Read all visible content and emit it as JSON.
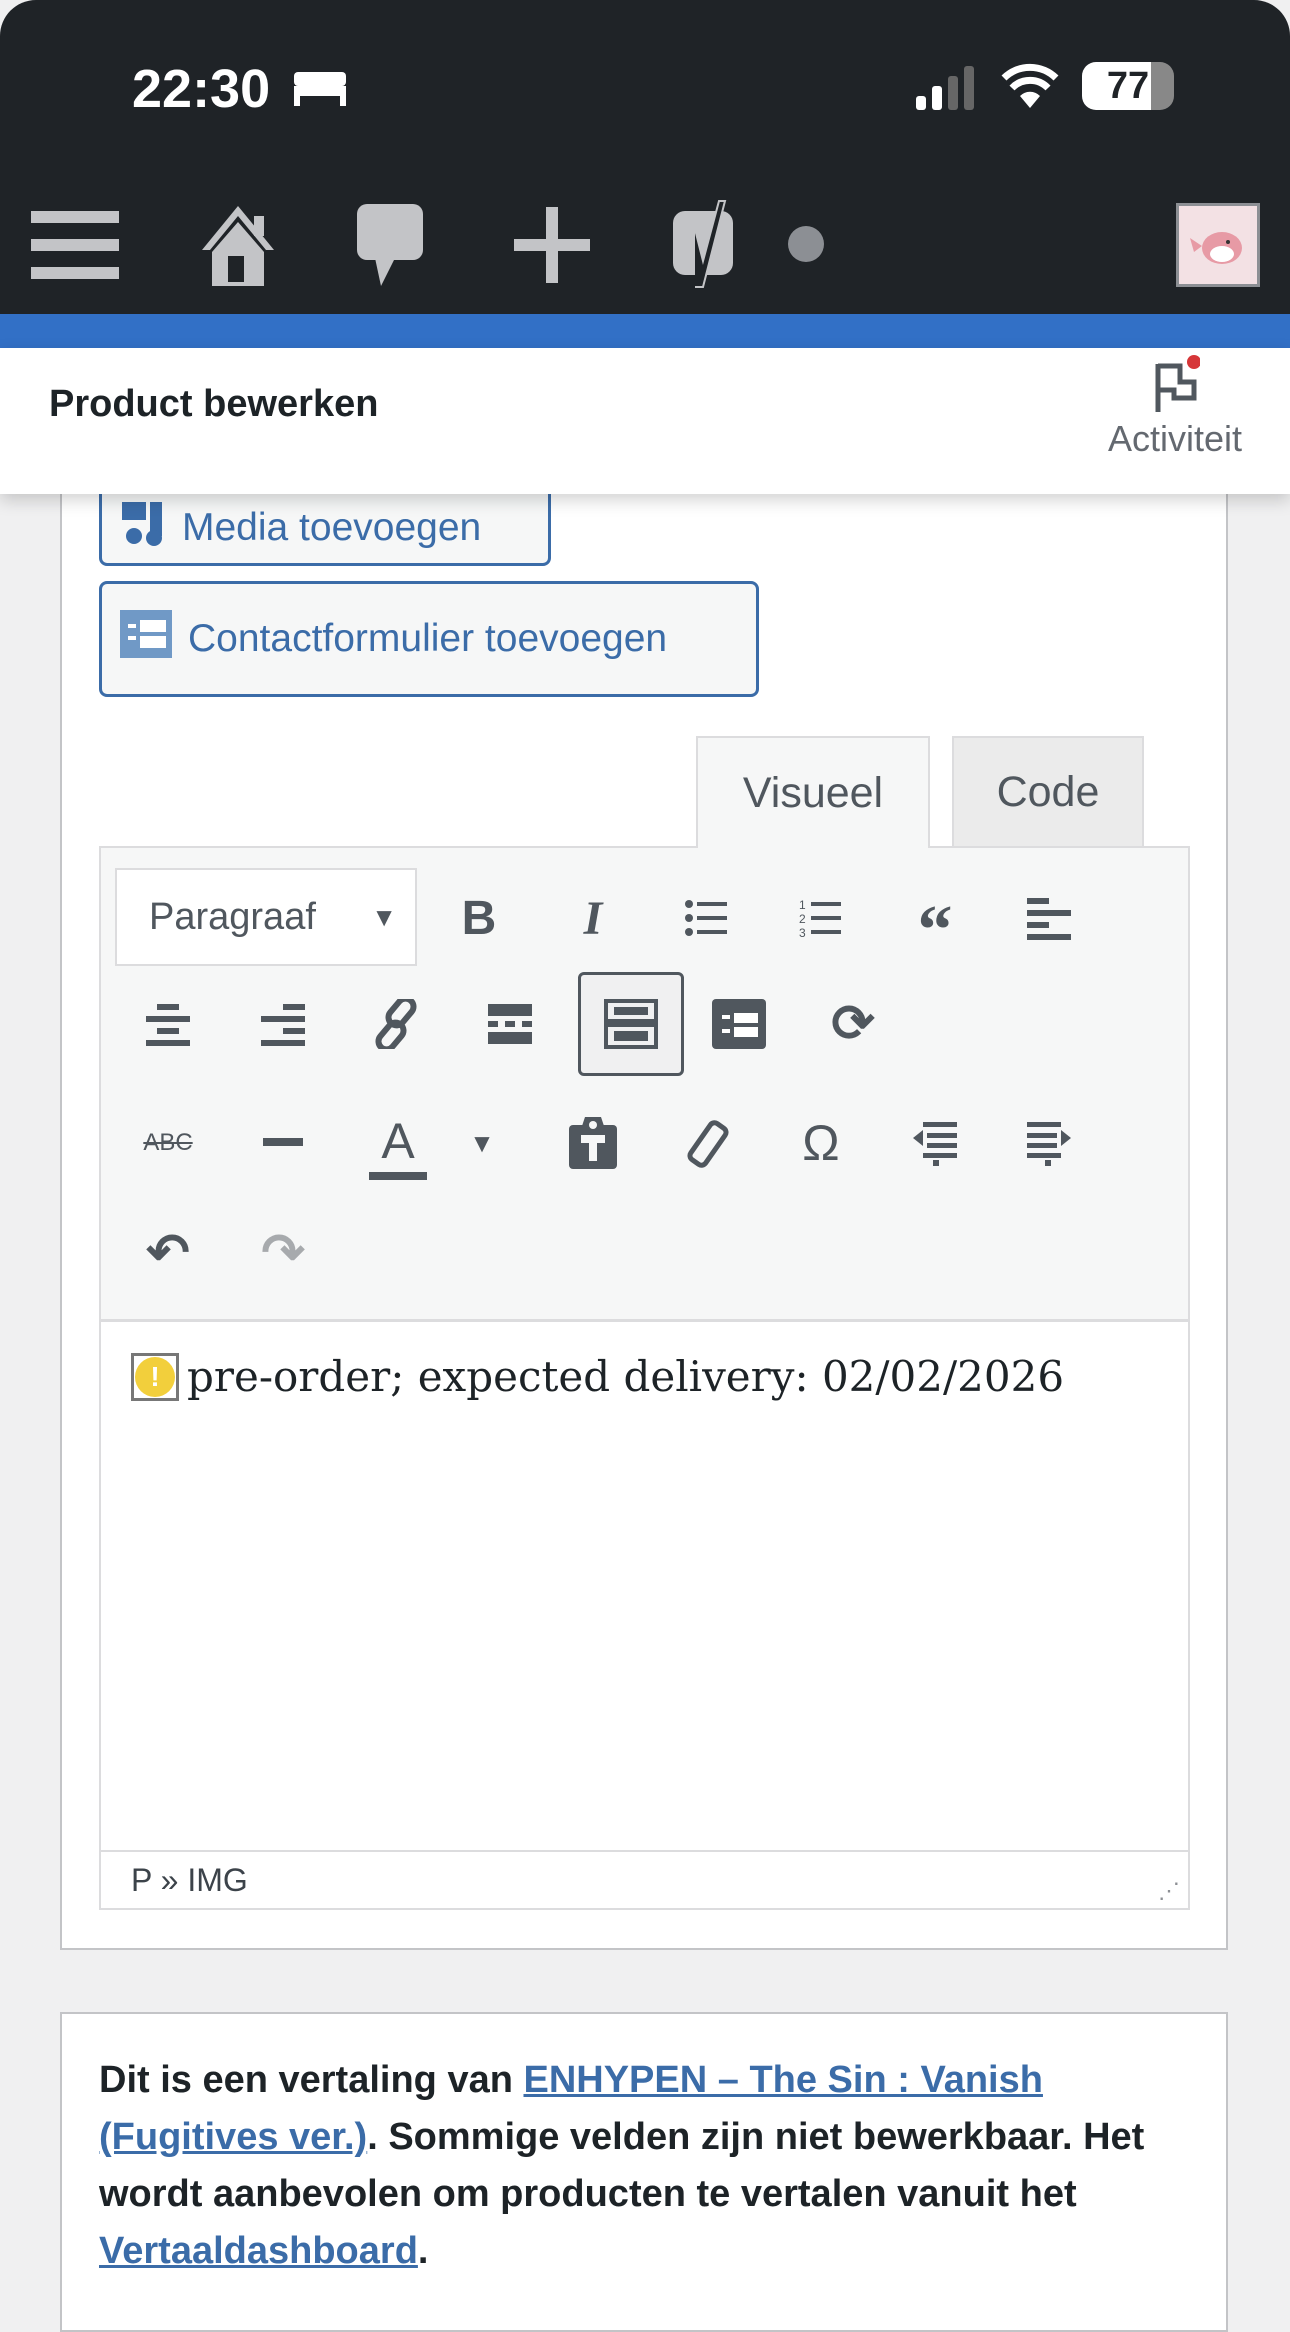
{
  "status_bar": {
    "time": "22:30",
    "battery": "77"
  },
  "admin_bar": {
    "icons": [
      "menu-icon",
      "home-icon",
      "comments-icon",
      "new-icon",
      "yoast-icon",
      "status-dot-icon",
      "avatar"
    ]
  },
  "header": {
    "title": "Product bewerken",
    "activity_label": "Activiteit"
  },
  "editor": {
    "media_button": "Media toevoegen",
    "contact_button": "Contactformulier toevoegen",
    "tabs": [
      {
        "label": "Visueel",
        "active": true
      },
      {
        "label": "Code",
        "active": false
      }
    ],
    "format_select": "Paragraaf",
    "content": "pre-order; expected delivery: 02/02/2026",
    "path": "P » IMG"
  },
  "notice": {
    "text_1": "Dit is een vertaling van ",
    "link_1": "ENHYPEN – The Sin : Vanish (Fugitives ver.)",
    "text_2": ". Sommige velden zijn niet bewerkbaar. Het wordt aanbevolen om producten te vertalen vanuit het ",
    "link_2": "Vertaaldashboard",
    "text_3": "."
  },
  "colors": {
    "admin_bar": "#1f2327",
    "accent_bar": "#3270c6",
    "link": "#3b6ca8"
  }
}
